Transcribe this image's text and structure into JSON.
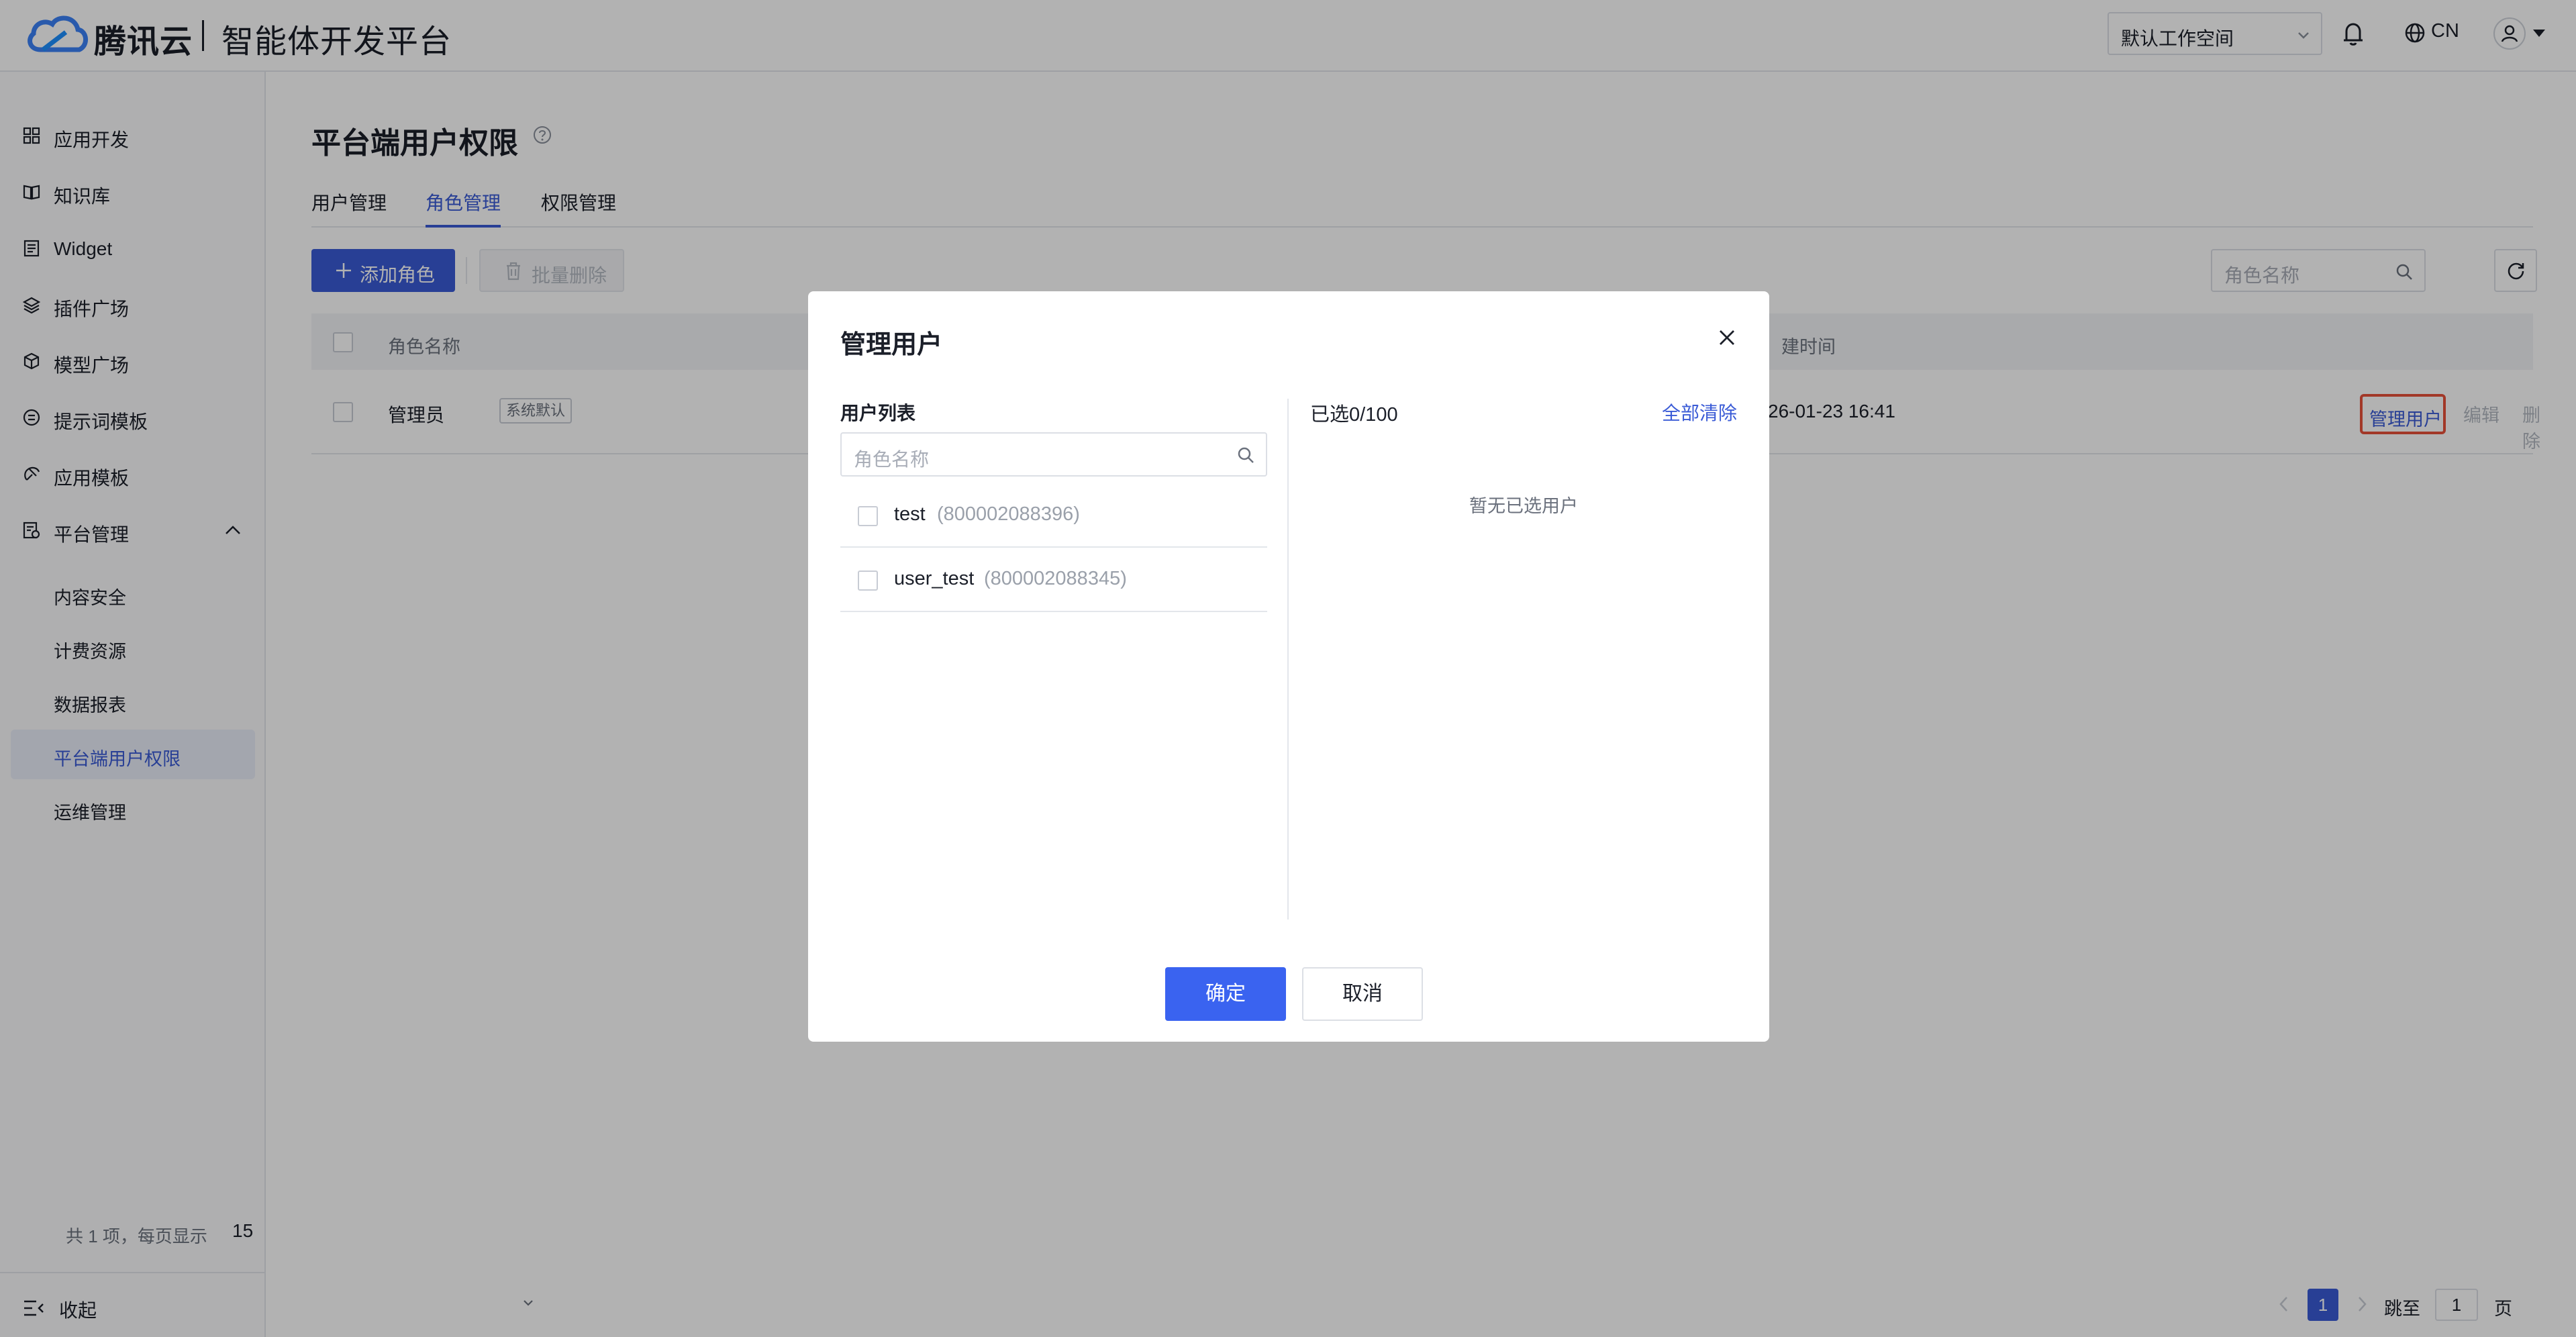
{
  "header": {
    "brand": "腾讯云",
    "product": "智能体开发平台",
    "workspace": "默认工作空间",
    "lang": "CN"
  },
  "sidebar": {
    "items": [
      {
        "label": "应用开发",
        "icon": "grid-icon"
      },
      {
        "label": "知识库",
        "icon": "book-icon"
      },
      {
        "label": "Widget",
        "icon": "widget-icon"
      },
      {
        "label": "插件广场",
        "icon": "layers-icon"
      },
      {
        "label": "模型广场",
        "icon": "cube-icon"
      },
      {
        "label": "提示词模板",
        "icon": "prompt-icon"
      },
      {
        "label": "应用模板",
        "icon": "template-icon"
      },
      {
        "label": "平台管理",
        "icon": "platform-icon"
      }
    ],
    "sub_items": [
      {
        "label": "内容安全"
      },
      {
        "label": "计费资源"
      },
      {
        "label": "数据报表"
      },
      {
        "label": "平台端用户权限"
      },
      {
        "label": "运维管理"
      }
    ],
    "collapse_label": "收起"
  },
  "main": {
    "title": "平台端用户权限",
    "tabs": [
      {
        "label": "用户管理"
      },
      {
        "label": "角色管理"
      },
      {
        "label": "权限管理"
      }
    ],
    "active_tab": "角色管理",
    "add_button": "添加角色",
    "batch_delete_button": "批量删除",
    "search_placeholder": "角色名称",
    "table": {
      "columns": [
        "角色名称",
        "建时间"
      ],
      "rows": [
        {
          "name": "管理员",
          "tag": "系统默认",
          "created": "26-01-23 16:41",
          "ops": [
            "管理用户",
            "编辑",
            "删除"
          ]
        }
      ]
    },
    "pagination": {
      "summary": "共 1 项，每页显示",
      "page_size": "15",
      "current_page": "1",
      "goto_label": "跳至",
      "goto_value": "1",
      "page_unit": "页"
    }
  },
  "modal": {
    "title": "管理用户",
    "list_title": "用户列表",
    "search_placeholder": "角色名称",
    "users": [
      {
        "name": "test",
        "id": "(800002088396)"
      },
      {
        "name": "user_test",
        "id": "(800002088345)"
      }
    ],
    "selected_count": "已选0/100",
    "clear_all": "全部清除",
    "empty_text": "暂无已选用户",
    "ok_button": "确定",
    "cancel_button": "取消"
  },
  "colors": {
    "accent": "#3a5bd6",
    "primary_button": "#3a63f0",
    "highlight_outline": "#e8513a"
  }
}
